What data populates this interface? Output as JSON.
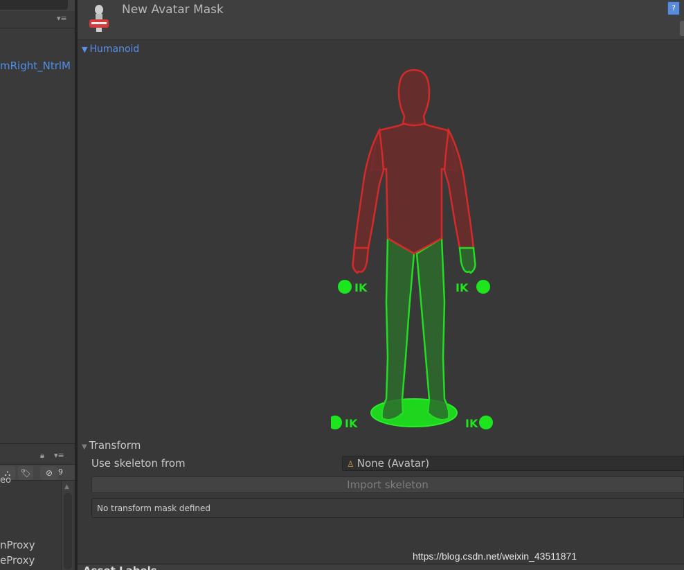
{
  "left_panel": {
    "list_item": "mRight_NtrlM",
    "partial_label": "eo",
    "visibility_count": "9",
    "proxy_items": [
      "nProxy",
      "eProxy"
    ]
  },
  "inspector": {
    "title": "New Avatar Mask",
    "help_icon": "?",
    "humanoid": {
      "label": "Humanoid",
      "body_part_colors": {
        "masked_red": "#d42a2a",
        "active_green": "#22dd22"
      },
      "ik_label": "IK"
    },
    "transform": {
      "label": "Transform",
      "skeleton_label": "Use skeleton from",
      "skeleton_value": "None (Avatar)",
      "import_button": "Import skeleton",
      "no_mask_message": "No transform mask defined"
    },
    "asset_labels": "Asset Labels"
  },
  "watermark": "https://blog.csdn.net/weixin_43511871"
}
